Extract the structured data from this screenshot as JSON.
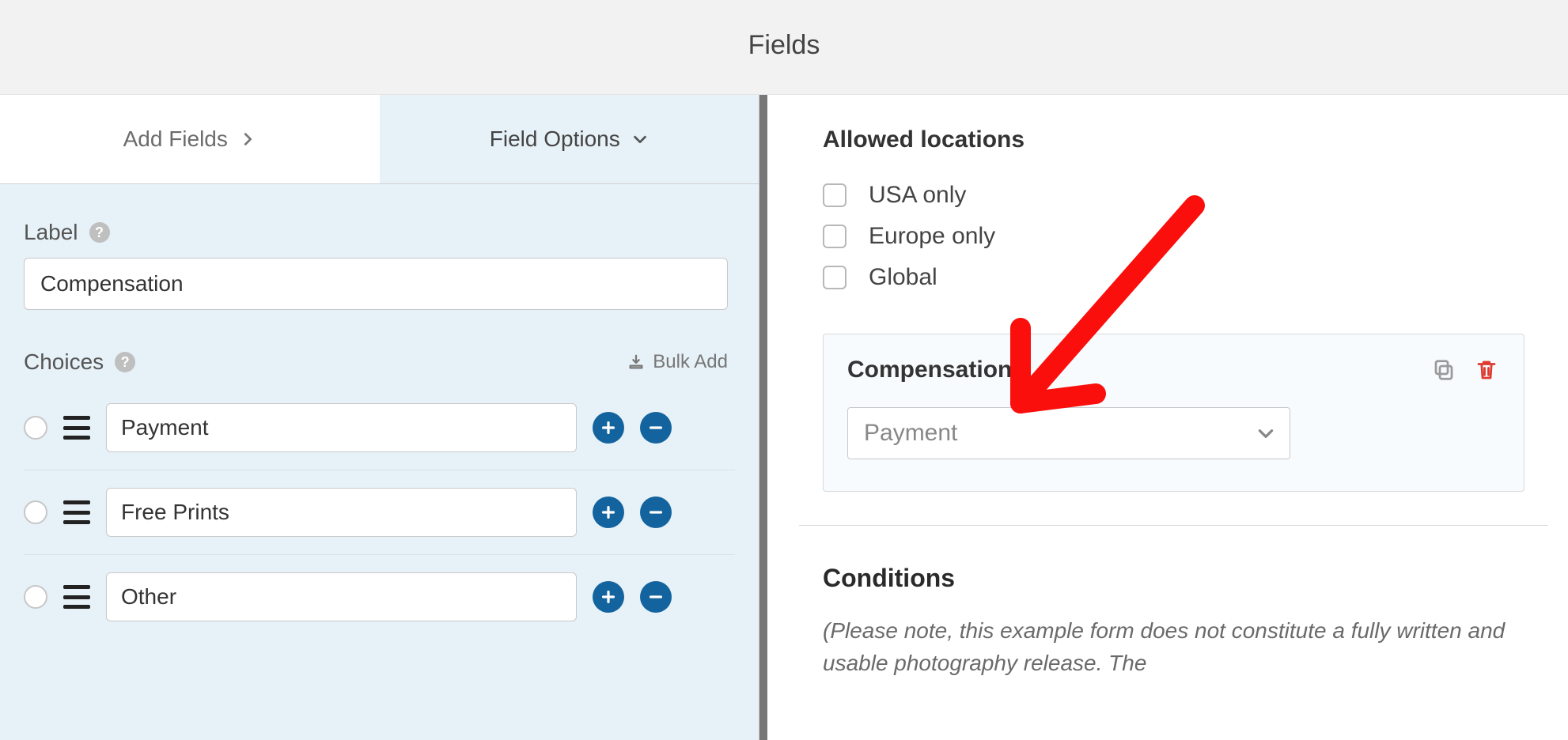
{
  "header": {
    "title": "Fields"
  },
  "tabs": {
    "add_fields": "Add Fields",
    "field_options": "Field Options"
  },
  "left": {
    "label_section": "Label",
    "label_value": "Compensation",
    "choices_section": "Choices",
    "bulk_add": "Bulk Add",
    "choices": [
      {
        "value": "Payment"
      },
      {
        "value": "Free Prints"
      },
      {
        "value": "Other"
      }
    ]
  },
  "right": {
    "allowed_locations_title": "Allowed locations",
    "location_options": [
      {
        "label": "USA only"
      },
      {
        "label": "Europe only"
      },
      {
        "label": "Global"
      }
    ],
    "field_card": {
      "title": "Compensation",
      "selected": "Payment"
    },
    "conditions_title": "Conditions",
    "conditions_note": "(Please note, this example form does not constitute a fully written and usable photography release. The"
  },
  "colors": {
    "accent": "#13649e",
    "danger": "#de3a2e",
    "panel_blue": "#e7f1f8",
    "annotation_red": "#fa0f0c"
  }
}
